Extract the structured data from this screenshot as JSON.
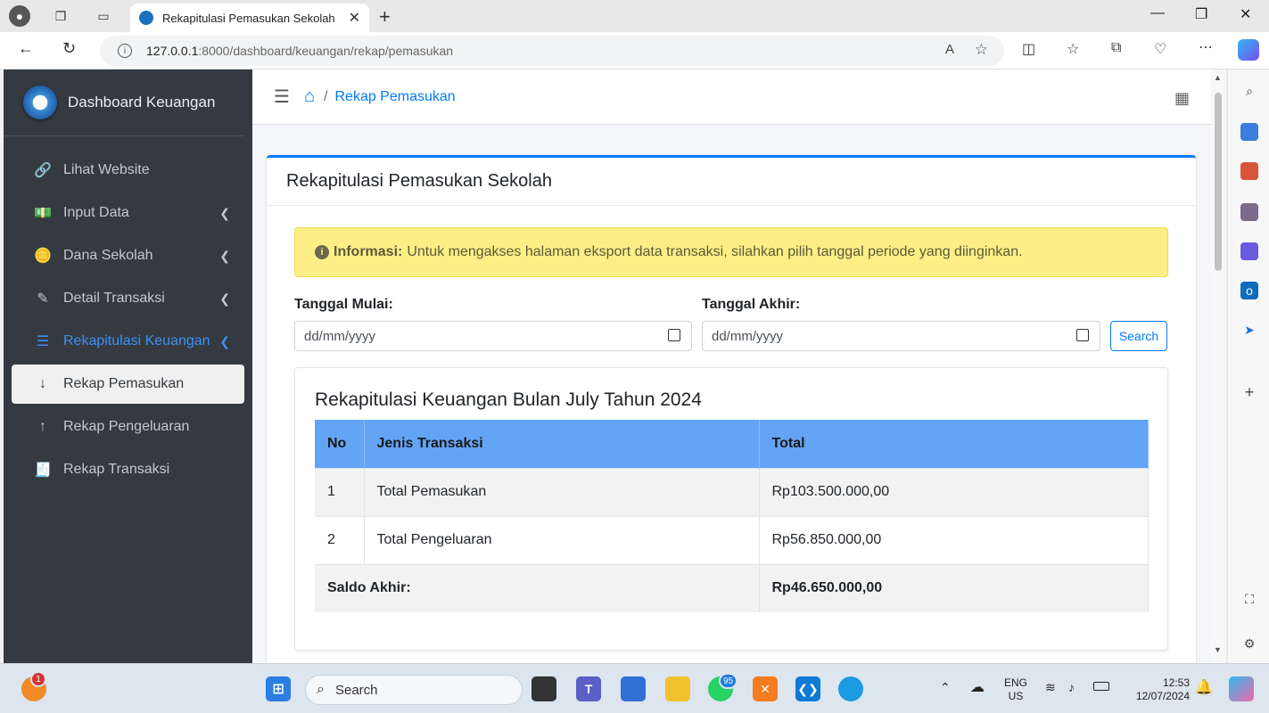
{
  "browser": {
    "tab_title": "Rekapitulasi Pemasukan Sekolah",
    "url_host": "127.0.0.1",
    "url_path": ":8000/dashboard/keuangan/rekap/pemasukan"
  },
  "sidebar": {
    "brand": "Dashboard Keuangan",
    "items": [
      {
        "label": "Lihat Website",
        "icon": "link-icon",
        "glyph": "🔗",
        "state": "normal",
        "chevron": false
      },
      {
        "label": "Input Data",
        "icon": "money-icon",
        "glyph": "💵",
        "state": "normal",
        "chevron": true
      },
      {
        "label": "Dana Sekolah",
        "icon": "coins-icon",
        "glyph": "🪙",
        "state": "normal",
        "chevron": true
      },
      {
        "label": "Detail Transaksi",
        "icon": "pencil-icon",
        "glyph": "✎",
        "state": "normal",
        "chevron": true
      },
      {
        "label": "Rekapitulasi Keuangan",
        "icon": "list-icon",
        "glyph": "☰",
        "state": "active-parent",
        "chevron": true
      },
      {
        "label": "Rekap Pemasukan",
        "icon": "arrow-down-icon",
        "glyph": "↓",
        "state": "active",
        "chevron": false
      },
      {
        "label": "Rekap Pengeluaran",
        "icon": "arrow-up-icon",
        "glyph": "↑",
        "state": "normal",
        "chevron": false
      },
      {
        "label": "Rekap Transaksi",
        "icon": "invoice-icon",
        "glyph": "🧾",
        "state": "normal",
        "chevron": false
      }
    ]
  },
  "header": {
    "breadcrumb_current": "Rekap Pemasukan"
  },
  "card": {
    "title": "Rekapitulasi Pemasukan Sekolah",
    "alert_label": "Informasi:",
    "alert_text": "Untuk mengakses halaman eksport data transaksi, silahkan pilih tanggal periode yang diinginkan.",
    "start_label": "Tanggal Mulai:",
    "start_placeholder": "dd/mm/yyyy",
    "end_label": "Tanggal Akhir:",
    "end_placeholder": "dd/mm/yyyy",
    "search_label": "Search"
  },
  "summary": {
    "title": "Rekapitulasi Keuangan Bulan July Tahun 2024",
    "columns": [
      "No",
      "Jenis Transaksi",
      "Total"
    ],
    "rows": [
      {
        "no": "1",
        "jenis": "Total Pemasukan",
        "total": "Rp103.500.000,00"
      },
      {
        "no": "2",
        "jenis": "Total Pengeluaran",
        "total": "Rp56.850.000,00"
      }
    ],
    "footer_label": "Saldo Akhir:",
    "footer_total": "Rp46.650.000,00"
  },
  "taskbar": {
    "search_label": "Search",
    "whatsapp_badge": "95",
    "notif_badge": "1",
    "lang_top": "ENG",
    "lang_bottom": "US",
    "time": "12:53",
    "date": "12/07/2024"
  },
  "colors": {
    "sidebar_bg": "#343a40",
    "accent": "#007bff",
    "table_header": "#63a4f5",
    "alert_bg": "#fdef86"
  }
}
